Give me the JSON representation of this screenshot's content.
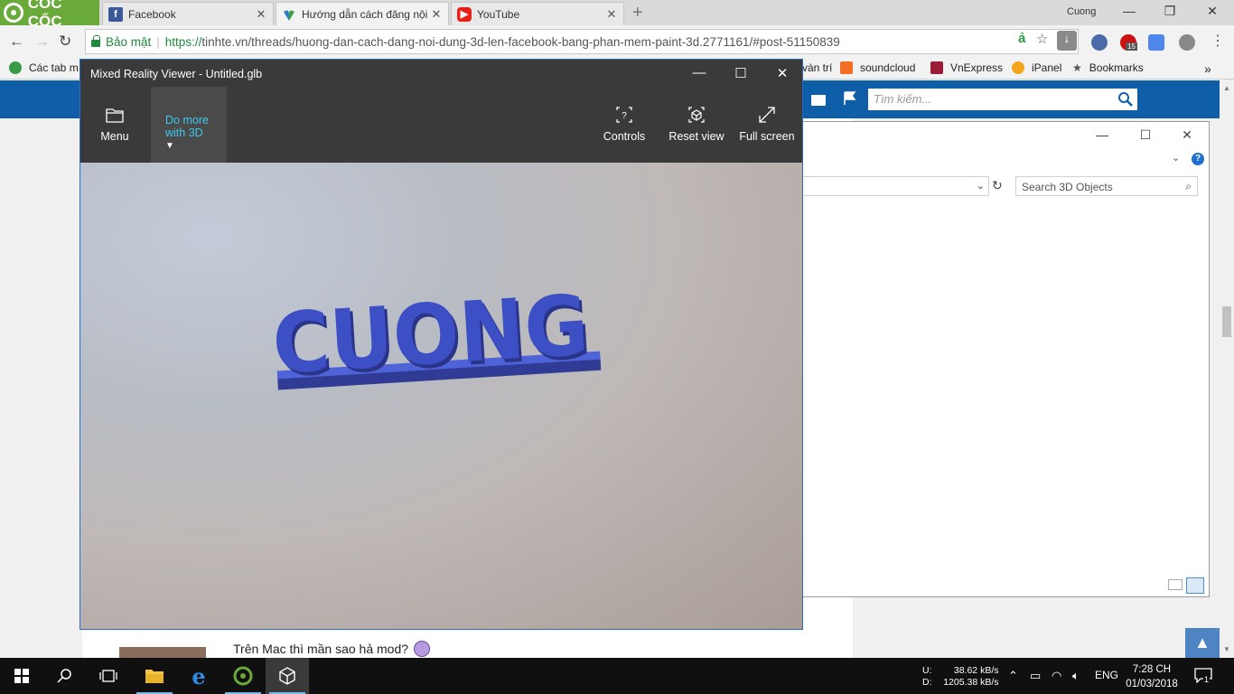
{
  "browser": {
    "brand": "CỐC CỐC",
    "tabs": [
      {
        "label": "Facebook",
        "icon": "facebook-icon",
        "color": "#3b5998"
      },
      {
        "label": "Hướng dẫn cách đăng nội",
        "icon": "tinhte-icon",
        "color": "#2a7bc8"
      },
      {
        "label": "YouTube",
        "icon": "youtube-icon",
        "color": "#e62117"
      }
    ],
    "profile": "Cuong",
    "secure_label": "Bảo mật",
    "url_scheme": "https://",
    "url_rest": "tinhte.vn/threads/huong-dan-cach-dang-noi-dung-3d-len-facebook-bang-phan-mem-paint-3d.2771161/#post-51150839",
    "extension_badge": "15",
    "bookmarks": {
      "apps_label": "Các tab m",
      "partial": "vàn trí",
      "items": [
        "soundcloud",
        "VnExpress",
        "iPanel",
        "Bookmarks"
      ],
      "more": "»"
    }
  },
  "site": {
    "search_placeholder": "Tìm kiếm...",
    "post_text": "Trên Mac thì mần sao hả mod?",
    "back_to_top": "▲"
  },
  "explorer": {
    "search_placeholder": "Search 3D Objects"
  },
  "viewer": {
    "title": "Mixed Reality Viewer - Untitled.glb",
    "menu_label": "Menu",
    "do_more_line1": "Do more",
    "do_more_line2": "with 3D",
    "controls_label": "Controls",
    "reset_label": "Reset view",
    "fullscreen_label": "Full screen",
    "model_text": "CUONG",
    "model_color": "#3d4fc4"
  },
  "taskbar": {
    "net_upload_label": "U:",
    "net_upload": "38.62 kB/s",
    "net_download_label": "D:",
    "net_download": "1205.38 kB/s",
    "lang": "ENG",
    "time": "7:28 CH",
    "date": "01/03/2018",
    "notification_count": "1"
  }
}
